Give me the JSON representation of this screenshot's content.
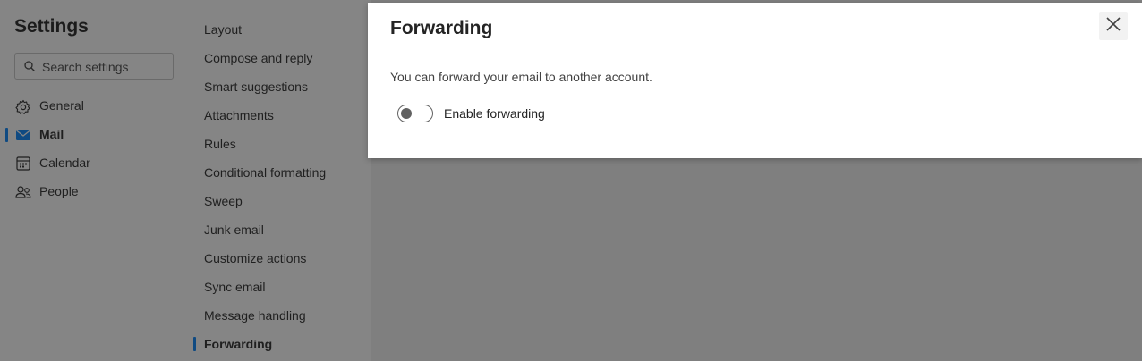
{
  "settings": {
    "title": "Settings",
    "search_placeholder": "Search settings"
  },
  "categories": [
    {
      "label": "General",
      "icon": "gear-icon",
      "selected": false
    },
    {
      "label": "Mail",
      "icon": "mail-icon",
      "selected": true
    },
    {
      "label": "Calendar",
      "icon": "calendar-icon",
      "selected": false
    },
    {
      "label": "People",
      "icon": "people-icon",
      "selected": false
    }
  ],
  "mail_settings": [
    "Layout",
    "Compose and reply",
    "Smart suggestions",
    "Attachments",
    "Rules",
    "Conditional formatting",
    "Sweep",
    "Junk email",
    "Customize actions",
    "Sync email",
    "Message handling",
    "Forwarding"
  ],
  "selected_mail_setting": "Forwarding",
  "panel": {
    "title": "Forwarding",
    "description": "You can forward your email to another account.",
    "toggle_label": "Enable forwarding",
    "toggle_on": false,
    "close_icon": "close-icon"
  },
  "colors": {
    "accent": "#0f4a82",
    "overlay": "#808080",
    "panel_bg": "#ffffff"
  }
}
